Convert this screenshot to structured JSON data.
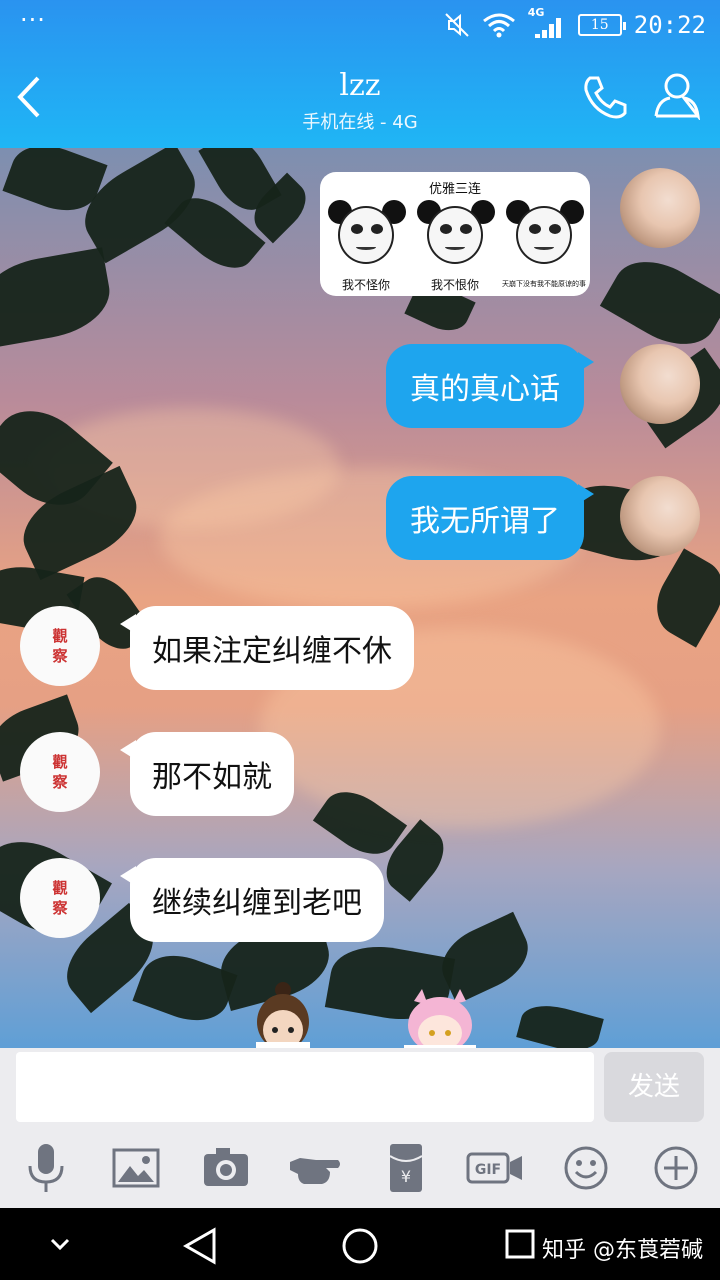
{
  "status_bar": {
    "time": "20:22",
    "battery": "15",
    "network": "4G"
  },
  "header": {
    "title": "lzz",
    "subtitle": "手机在线 - 4G"
  },
  "sticker": {
    "title": "优雅三连",
    "captions": [
      "我不怪你",
      "我不恨你",
      "天崩下没有我不能原谅的事"
    ]
  },
  "messages": [
    {
      "side": "out",
      "text": "真的真心话"
    },
    {
      "side": "out",
      "text": "我无所谓了"
    },
    {
      "side": "in",
      "text": "如果注定纠缠不休"
    },
    {
      "side": "in",
      "text": "那不如就"
    },
    {
      "side": "in",
      "text": "继续纠缠到老吧"
    }
  ],
  "contact_avatar_text": [
    "觀",
    "察"
  ],
  "input": {
    "placeholder": "",
    "send_label": "发送"
  },
  "toolbar": [
    "microphone-icon",
    "image-icon",
    "camera-icon",
    "poke-icon",
    "red-packet-icon",
    "gif-icon",
    "emoji-icon",
    "plus-icon"
  ],
  "watermark": "知乎 @东莨菪碱"
}
